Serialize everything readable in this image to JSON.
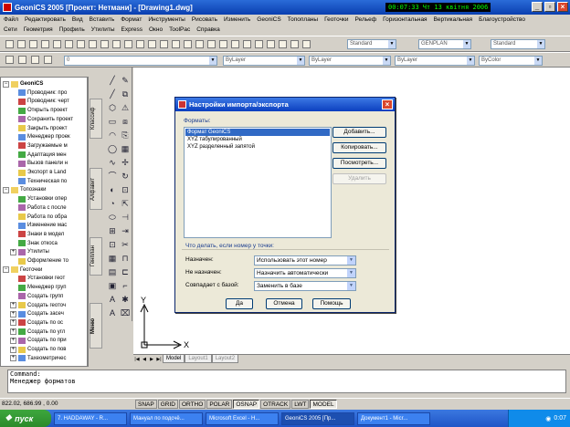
{
  "window": {
    "app_title": "GeoniCS 2005 [Проект: Нетмани] - [Drawing1.dwg]",
    "clock_time": "00:07:33",
    "clock_date": "Чт 13 квітня 2006"
  },
  "menu_primary": [
    "Файл",
    "Редактировать",
    "Вид",
    "Вставить",
    "Формат",
    "Инструменты",
    "Рисовать",
    "Изменить",
    "GeoniCS",
    "Топопланы",
    "Геоточки",
    "Рельеф",
    "Горизонтальная",
    "Вертикальная",
    "Благоустройство"
  ],
  "menu_secondary": [
    "Сети",
    "Геометрия",
    "Профиль",
    "Утилиты",
    "Express",
    "Окно",
    "ToolPac",
    "Справка"
  ],
  "toolbars": {
    "layer_value": "0",
    "style1": "Standard",
    "style2": "GENPLAN",
    "style3": "Standard",
    "color": "ByLayer",
    "linetype": "ByLayer",
    "lineweight": "ByLayer",
    "plotstyle": "ByColor"
  },
  "tree": [
    {
      "label": "GeoniCS",
      "level": 0,
      "pm": "−",
      "bold": true
    },
    {
      "label": "Проводник: про",
      "level": 1
    },
    {
      "label": "Проводник: черт",
      "level": 1
    },
    {
      "label": "Открыть проект",
      "level": 1
    },
    {
      "label": "Сохранить проект",
      "level": 1
    },
    {
      "label": "Закрыть проект",
      "level": 1
    },
    {
      "label": "Менеджер проек",
      "level": 1
    },
    {
      "label": "Загружаемые м",
      "level": 1
    },
    {
      "label": "Адаптация мен",
      "level": 1
    },
    {
      "label": "Вызов панели н",
      "level": 1
    },
    {
      "label": "Экспорт в Land",
      "level": 1
    },
    {
      "label": "Техническая по",
      "level": 1
    },
    {
      "label": "Топознаки",
      "level": 0,
      "pm": "−"
    },
    {
      "label": "Установки опер",
      "level": 1
    },
    {
      "label": "Работа с после",
      "level": 1
    },
    {
      "label": "Работа по обра",
      "level": 1
    },
    {
      "label": "Изменение мас",
      "level": 1
    },
    {
      "label": "Знаки в модел",
      "level": 1
    },
    {
      "label": "Знак откоса",
      "level": 1
    },
    {
      "label": "Утилиты",
      "level": 1,
      "pm": "+"
    },
    {
      "label": "Оформление то",
      "level": 1
    },
    {
      "label": "Геоточки",
      "level": 0,
      "pm": "−"
    },
    {
      "label": "Установки геот",
      "level": 1
    },
    {
      "label": "Менеджер груп",
      "level": 1
    },
    {
      "label": "Создать групп",
      "level": 1
    },
    {
      "label": "Создать геоточ",
      "level": 1,
      "pm": "+"
    },
    {
      "label": "Создать засеч",
      "level": 1,
      "pm": "+"
    },
    {
      "label": "Создать по ос",
      "level": 1,
      "pm": "+"
    },
    {
      "label": "Создать по угл",
      "level": 1,
      "pm": "+"
    },
    {
      "label": "Создать по при",
      "level": 1,
      "pm": "+"
    },
    {
      "label": "Создать по пов",
      "level": 1,
      "pm": "+"
    },
    {
      "label": "Тахеометричес",
      "level": 1,
      "pm": "+"
    }
  ],
  "side_tabs": [
    "Классиф",
    "Алфавит",
    "Генплан",
    "Меню"
  ],
  "draw_tools": [
    "╱",
    "╱",
    "⬡",
    "▭",
    "◠",
    "◯",
    "∿",
    "⌒",
    "◐",
    "◔",
    "⬭",
    "⊞",
    "⊡",
    "▦",
    "▤",
    "▣",
    "A",
    "A"
  ],
  "modify_tools": [
    "✎",
    "⧉",
    "⚠",
    "⧈",
    "⎘",
    "▦",
    "✢",
    "↻",
    "⊡",
    "⇱",
    "⊣",
    "⇥",
    "✂",
    "⊓",
    "⊏",
    "⌐",
    "✱",
    "⌧"
  ],
  "layout_tabs": [
    "Model",
    "Layout1",
    "Layout2"
  ],
  "ucs": {
    "x_label": "X",
    "y_label": "Y"
  },
  "command": {
    "line1": "Command:",
    "line2": "Менеджер форматов"
  },
  "status": {
    "coords": "822.02,  686.99  ,  0.00",
    "toggles": [
      {
        "label": "SNAP",
        "on": false
      },
      {
        "label": "GRID",
        "on": false
      },
      {
        "label": "ORTHO",
        "on": false
      },
      {
        "label": "POLAR",
        "on": false
      },
      {
        "label": "OSNAP",
        "on": true
      },
      {
        "label": "OTRACK",
        "on": false
      },
      {
        "label": "LWT",
        "on": false
      },
      {
        "label": "MODEL",
        "on": true
      }
    ]
  },
  "taskbar": {
    "start": "пуск",
    "tasks": [
      "7. HADDAWAY - R...",
      "Мануал по подсчё...",
      "Microsoft Excel - H...",
      "GeoniCS 2005 [Пр...",
      "Документ1 - Micr..."
    ],
    "time": "0:07"
  },
  "dialog": {
    "title": "Настройки импорта/экспорта",
    "formats_label": "Форматы:",
    "formats": [
      "Формат GeoniCS",
      "XYZ табулированный",
      "XYZ разделенный запятой"
    ],
    "selected_index": 0,
    "buttons": {
      "add": "Добавить...",
      "copy": "Копировать...",
      "view": "Посмотреть...",
      "delete": "Удалить",
      "ok": "Да",
      "cancel": "Отмена",
      "help": "Помощь"
    },
    "point_group_label": "Что делать, если номер у точки:",
    "rows": [
      {
        "label": "Назначен:",
        "value": "Использовать этот номер"
      },
      {
        "label": "Не назначен:",
        "value": "Назначить автоматически"
      },
      {
        "label": "Совпадает с базой:",
        "value": "Заменить в базе"
      }
    ]
  }
}
